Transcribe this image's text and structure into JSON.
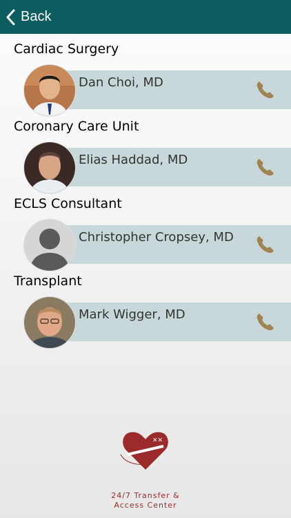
{
  "header": {
    "back_label": "Back",
    "accent": "#0c5d5f"
  },
  "sections": [
    {
      "title": "Cardiac Surgery",
      "doctor": "Dan Choi, MD",
      "avatar": "photo"
    },
    {
      "title": "Coronary Care Unit",
      "doctor": "Elias Haddad, MD",
      "avatar": "photo"
    },
    {
      "title": "ECLS Consultant",
      "doctor": "Christopher Cropsey, MD",
      "avatar": "placeholder"
    },
    {
      "title": "Transplant",
      "doctor": "Mark Wigger, MD",
      "avatar": "photo"
    }
  ],
  "footer": {
    "line1": "24/7 Transfer &",
    "line2": "Access Center",
    "logo_icon": "heart-logo-icon"
  },
  "colors": {
    "row_bg": "#c7d7da",
    "phone": "#a0834f",
    "logo": "#9b2a2a"
  }
}
